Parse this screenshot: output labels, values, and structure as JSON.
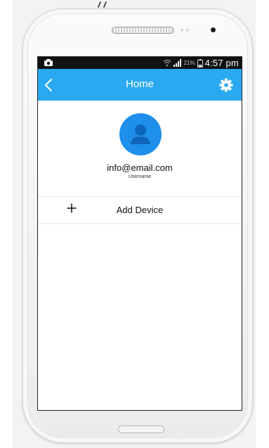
{
  "status_bar": {
    "battery_percent": "21%",
    "time": "4:57 pm",
    "icons": [
      "notification-icon",
      "wifi-icon",
      "signal-icon",
      "battery-icon"
    ]
  },
  "app_bar": {
    "title": "Home",
    "back_icon": "chevron-left-icon",
    "settings_icon": "gear-icon",
    "color": "#2aa9f1"
  },
  "profile": {
    "email": "info@email.com",
    "label": "Username",
    "avatar_icon": "user-icon",
    "avatar_color": "#1e8fea"
  },
  "actions": {
    "add_device_label": "Add Device",
    "add_icon": "plus-icon"
  }
}
